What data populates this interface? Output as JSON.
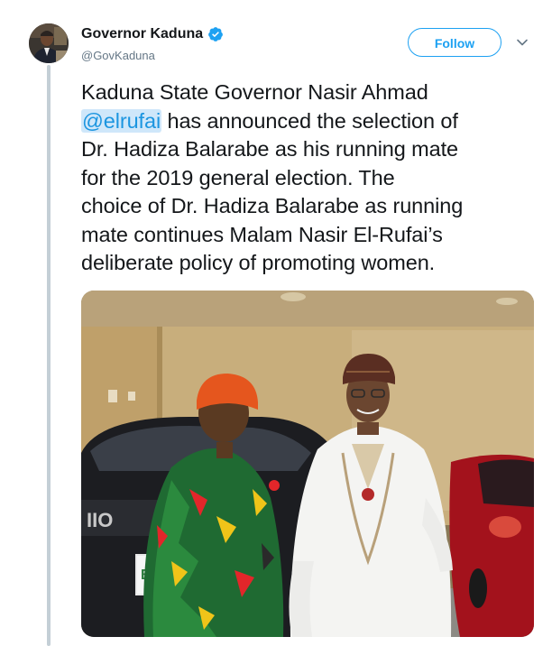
{
  "account": {
    "display_name": "Governor Kaduna",
    "handle": "@GovKaduna",
    "verified": true
  },
  "follow_button": {
    "label": "Follow"
  },
  "tweet": {
    "line1": "Kaduna State Governor Nasir Ahmad",
    "mention": "@elrufai",
    "line2_rest": " has announced the selection of",
    "line3": "Dr. Hadiza Balarabe as his running mate",
    "line4": "for the 2019 general election. The",
    "line5": "choice of Dr. Hadiza Balarabe as running",
    "line6": "mate continues Malam Nasir El-Rufai’s",
    "line7": "deliberate policy of promoting women."
  },
  "photo": {
    "alt": "Two people standing in front of parked cars in a garage",
    "car_badge_text": "IIO",
    "plate_text": "B"
  },
  "colors": {
    "accent": "#1da1f2",
    "mention": "#1b95e0",
    "mention_highlight": "#cfe7fa",
    "text": "#14171a",
    "secondary_text": "#657786",
    "thread_line": "#c4cfd6"
  },
  "icons": {
    "verified": "verified-badge-icon",
    "menu": "chevron-down-icon"
  }
}
